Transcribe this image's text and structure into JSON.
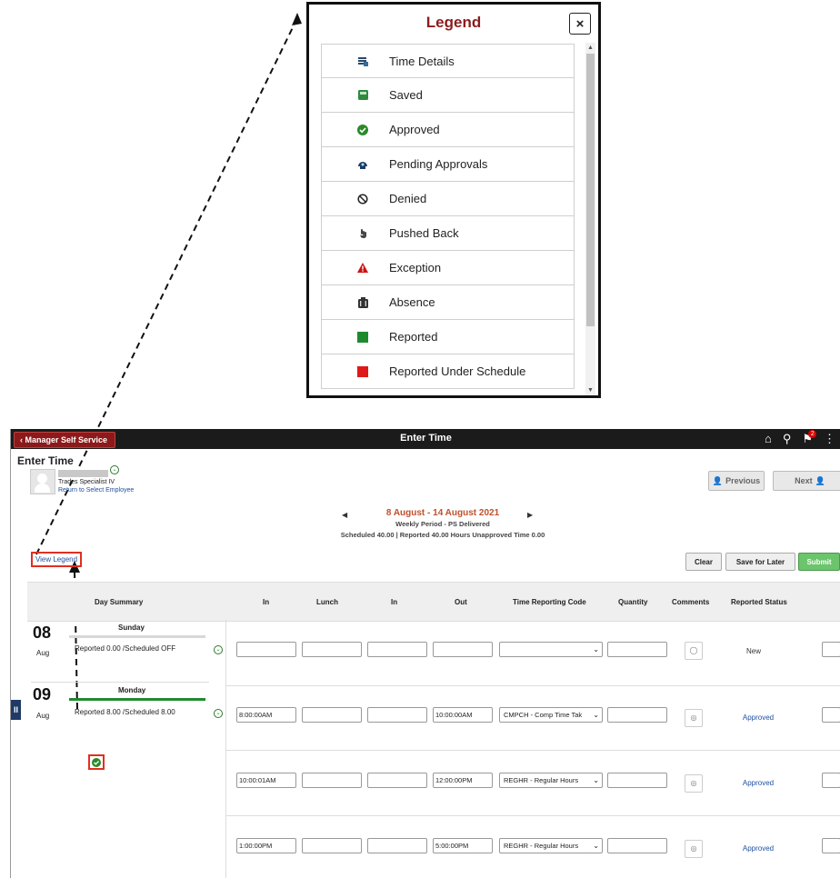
{
  "legend": {
    "title": "Legend",
    "close": "×",
    "items": [
      {
        "label": "Time Details",
        "icon": "time-details-icon"
      },
      {
        "label": "Saved",
        "icon": "saved-icon"
      },
      {
        "label": "Approved",
        "icon": "approved-icon"
      },
      {
        "label": "Pending Approvals",
        "icon": "pending-approvals-icon"
      },
      {
        "label": "Denied",
        "icon": "denied-icon"
      },
      {
        "label": "Pushed Back",
        "icon": "pushed-back-icon"
      },
      {
        "label": "Exception",
        "icon": "exception-icon"
      },
      {
        "label": "Absence",
        "icon": "absence-icon"
      },
      {
        "label": "Reported",
        "icon": "reported-icon"
      },
      {
        "label": "Reported Under Schedule",
        "icon": "reported-under-schedule-icon"
      }
    ]
  },
  "topbar": {
    "back": "Manager Self Service",
    "title": "Enter Time",
    "badge": "2"
  },
  "header": {
    "page_title": "Enter Time",
    "job_title": "Trades Specialist IV",
    "return_link": "Return to Select Employee",
    "previous": "Previous",
    "next": "Next"
  },
  "period": {
    "title": "8 August - 14 August 2021",
    "subtitle": "Weekly Period - PS Delivered",
    "summary": "Scheduled  40.00  |  Reported  40.00 Hours  Unapproved Time  0.00"
  },
  "actions": {
    "view_legend": "View Legend",
    "clear": "Clear",
    "save": "Save for Later",
    "submit": "Submit"
  },
  "columns": [
    "Day Summary",
    "In",
    "Lunch",
    "In",
    "Out",
    "Time Reporting Code",
    "Quantity",
    "Comments",
    "Reported Status"
  ],
  "days": [
    {
      "num": "08",
      "month": "Aug",
      "name": "Sunday",
      "reported": "Reported 0.00 /Scheduled OFF",
      "bar_color": "#d8d8d8"
    },
    {
      "num": "09",
      "month": "Aug",
      "name": "Monday",
      "reported": "Reported 8.00 /Scheduled 8.00",
      "bar_color": "#1e8a2e"
    }
  ],
  "rows": [
    {
      "in": "",
      "lunch": "",
      "in2": "",
      "out": "",
      "trc": "",
      "qty": "",
      "status": "New",
      "status_color": "#333"
    },
    {
      "in": "8:00:00AM",
      "lunch": "",
      "in2": "",
      "out": "10:00:00AM",
      "trc": "CMPCH - Comp Time Tak",
      "qty": "",
      "status": "Approved",
      "status_color": "#2150a0"
    },
    {
      "in": "10:00:01AM",
      "lunch": "",
      "in2": "",
      "out": "12:00:00PM",
      "trc": "REGHR - Regular Hours",
      "qty": "",
      "status": "Approved",
      "status_color": "#2150a0"
    },
    {
      "in": "1:00:00PM",
      "lunch": "",
      "in2": "",
      "out": "5:00:00PM",
      "trc": "REGHR - Regular Hours",
      "qty": "",
      "status": "Approved",
      "status_color": "#2150a0"
    }
  ]
}
